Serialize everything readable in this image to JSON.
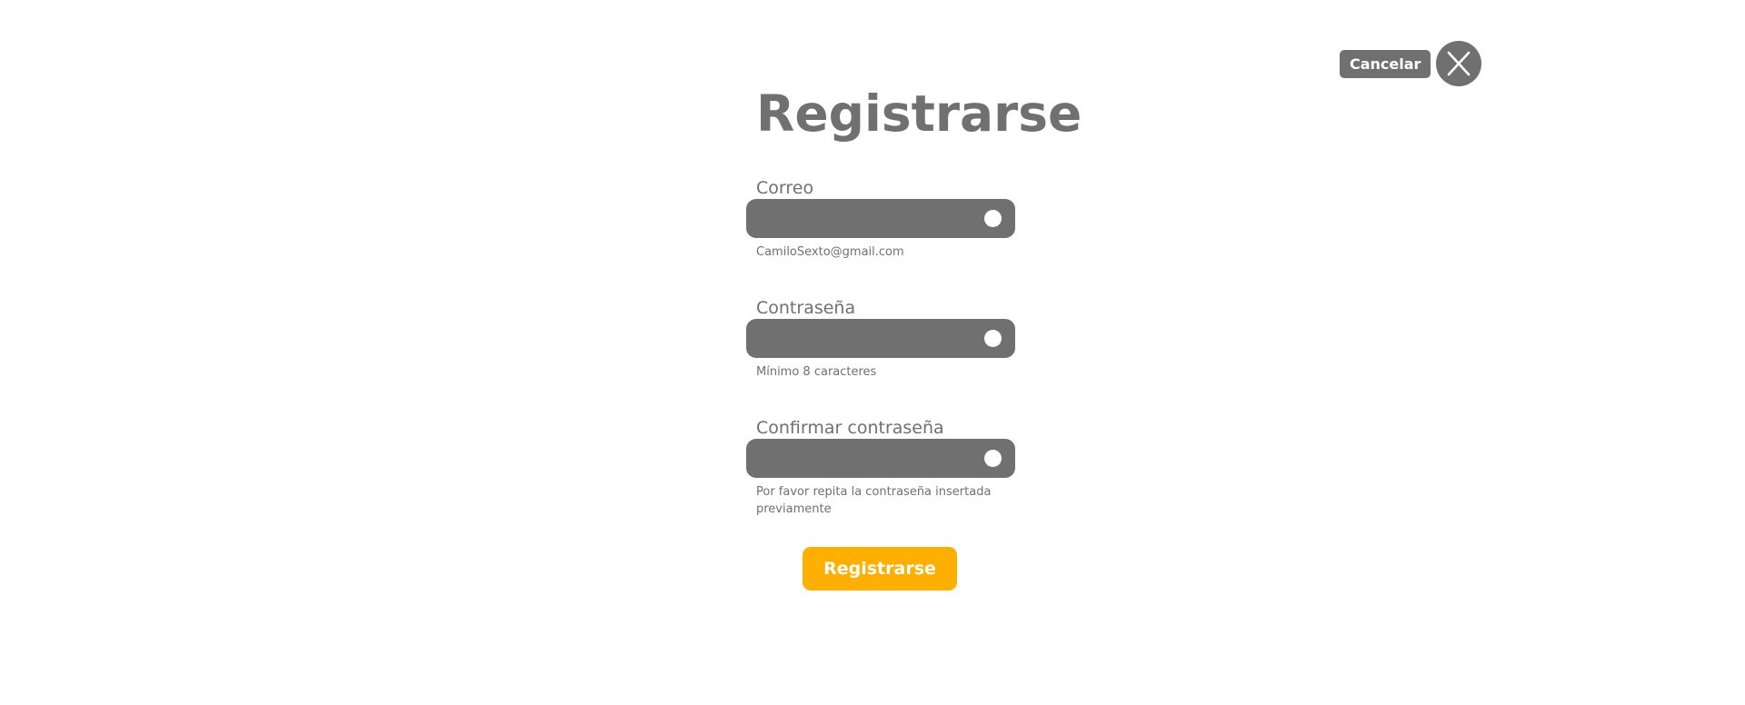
{
  "header": {
    "cancel_label": "Cancelar",
    "close_icon": "close-icon"
  },
  "form": {
    "title": "Registrarse",
    "fields": [
      {
        "label": "Correo",
        "value": "",
        "hint": "CamiloSexto@gmail.com",
        "indicator_icon": "circle-indicator-icon"
      },
      {
        "label": "Contraseña",
        "value": "",
        "hint": "Mínimo 8 caracteres",
        "indicator_icon": "circle-indicator-icon"
      },
      {
        "label": "Confirmar contraseña",
        "value": "",
        "hint": "Por favor repita la contraseña insertada previamente",
        "indicator_icon": "circle-indicator-icon"
      }
    ],
    "submit_label": "Registrarse"
  },
  "colors": {
    "primary_gray": "#707070",
    "accent": "#FFAF00",
    "background": "#FFFFFF",
    "text_on_dark": "#FFFFFF"
  }
}
